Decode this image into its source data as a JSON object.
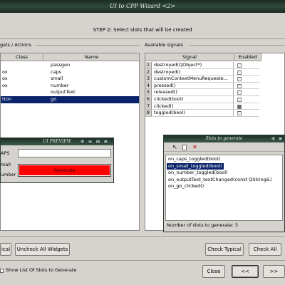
{
  "window": {
    "title": "UI to CPP Wizard <2>"
  },
  "step_text": "STEP 2: Select slots that will be created",
  "left_panel": {
    "section_label": "gets / Actions",
    "columns": [
      "Class",
      "Name"
    ],
    "rows": [
      {
        "cls": "",
        "name": "passgen",
        "selected": false
      },
      {
        "cls": "ox",
        "name": "caps",
        "selected": false
      },
      {
        "cls": "ox",
        "name": "small",
        "selected": false
      },
      {
        "cls": "ox",
        "name": "number",
        "selected": false
      },
      {
        "cls": "",
        "name": "outputText",
        "selected": false
      },
      {
        "cls": "tton",
        "name": "go",
        "selected": true
      }
    ]
  },
  "right_panel": {
    "section_label": "Available signals",
    "columns": [
      "Signal",
      "Enabled"
    ],
    "rows": [
      {
        "num": "1",
        "signal": "destroyed(QObject*)",
        "enabled": false
      },
      {
        "num": "2",
        "signal": "destroyed()",
        "enabled": false
      },
      {
        "num": "3",
        "signal": "customContextMenuRequeste...",
        "enabled": false
      },
      {
        "num": "4",
        "signal": "pressed()",
        "enabled": false
      },
      {
        "num": "5",
        "signal": "released()",
        "enabled": false
      },
      {
        "num": "6",
        "signal": "clicked(bool)",
        "enabled": false
      },
      {
        "num": "7",
        "signal": "clicked()",
        "enabled": true
      },
      {
        "num": "8",
        "signal": "toggled(bool)",
        "enabled": false
      }
    ]
  },
  "preview": {
    "title": "UI PREVIEW",
    "title_buttons": [
      "?",
      "–",
      "□",
      "×"
    ],
    "labels": [
      "APS",
      "mall",
      "umber"
    ],
    "input_value": "",
    "generate_label": "Generate"
  },
  "slots": {
    "title": "Slots to generate",
    "title_buttons": [
      "?",
      "×"
    ],
    "items": [
      {
        "text": "on_caps_toggled(bool)",
        "selected": false
      },
      {
        "text": "on_small_toggled(bool)",
        "selected": true
      },
      {
        "text": "on_number_toggled(bool)",
        "selected": false
      },
      {
        "text": "on_outputText_textChanged(const QString&)",
        "selected": false
      },
      {
        "text": "on_go_clicked()",
        "selected": false
      }
    ],
    "count_text": "Number of slots to generate: 5"
  },
  "buttons": {
    "check_all_partial": "ical",
    "uncheck_all_widgets": "Uncheck All Widgets",
    "check_typical": "Check Typical",
    "check_all": "Check All",
    "close": "Close",
    "back": "<<",
    "next": ">>"
  },
  "show_list_label": "Show List Of Slots to Generate",
  "colors": {
    "selection": "#0a246a",
    "generate_button": "#ff0000",
    "titlebar": "#2f4a3c"
  }
}
